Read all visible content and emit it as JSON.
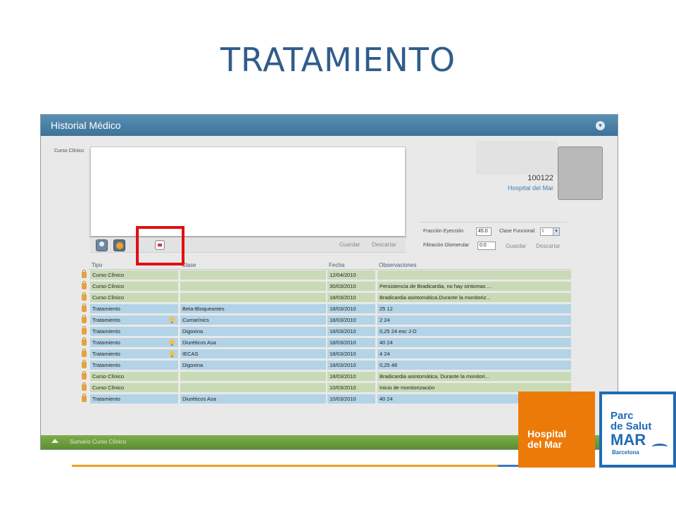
{
  "slide": {
    "title": "TRATAMIENTO"
  },
  "window": {
    "title": "Historial Médico",
    "collapse_icon": "chevron-down-icon"
  },
  "curso": {
    "label": "Curso Clínico",
    "text": "",
    "guardar": "Guardar",
    "descartar": "Descartar",
    "tool_icons": [
      "person-icon",
      "globe-icon",
      "pdf-icon"
    ]
  },
  "patient": {
    "id": "100122",
    "hospital": "Hospital del Mar"
  },
  "params": {
    "fraccion_label": "Fracción Eyección",
    "fraccion_value": "45.0",
    "clase_label": "Clase Funcional",
    "clase_value": "I",
    "filtracion_label": "Filtración Glomerular",
    "filtracion_value": "0.0",
    "guardar": "Guardar",
    "descartar": "Descartar"
  },
  "table": {
    "columns": [
      "Tipo",
      "Clase",
      "Fecha",
      "Observaciones"
    ],
    "rows": [
      {
        "tipo": "Curso Clínico",
        "clase": "",
        "fecha": "12/04/2010",
        "obs": "",
        "color": "green",
        "bulb": false
      },
      {
        "tipo": "Curso Clínico",
        "clase": "",
        "fecha": "30/03/2010",
        "obs": "Persistencia de Bradicardia, no hay síntomas ...",
        "color": "green",
        "bulb": false
      },
      {
        "tipo": "Curso Clínico",
        "clase": "",
        "fecha": "18/03/2010",
        "obs": "Bradicardia asintomática.Durante la monitoriz...",
        "color": "green",
        "bulb": false
      },
      {
        "tipo": "Tratamiento",
        "clase": "Beta-Bloqueantes",
        "fecha": "18/03/2010",
        "obs": "25 12",
        "color": "blue",
        "bulb": false
      },
      {
        "tipo": "Tratamiento",
        "clase": "Cumarínics",
        "fecha": "18/03/2010",
        "obs": "2 24",
        "color": "blue",
        "bulb": true
      },
      {
        "tipo": "Tratamiento",
        "clase": "Digoxina",
        "fecha": "18/03/2010",
        "obs": "0,25 24 exc J-D",
        "color": "blue",
        "bulb": false
      },
      {
        "tipo": "Tratamiento",
        "clase": "Diuréticos Asa",
        "fecha": "18/03/2010",
        "obs": "40 24",
        "color": "blue",
        "bulb": true
      },
      {
        "tipo": "Tratamiento",
        "clase": "IECAS",
        "fecha": "18/03/2010",
        "obs": "4 24",
        "color": "blue",
        "bulb": true
      },
      {
        "tipo": "Tratamiento",
        "clase": "Digoxina",
        "fecha": "18/03/2010",
        "obs": "0,25 48",
        "color": "blue",
        "bulb": false
      },
      {
        "tipo": "Curso Clínico",
        "clase": "",
        "fecha": "18/03/2010",
        "obs": "Bradicardia asintomática. Durante la monitori...",
        "color": "green",
        "bulb": false
      },
      {
        "tipo": "Curso Clínico",
        "clase": "",
        "fecha": "10/03/2010",
        "obs": "Inicio de monitorización",
        "color": "green",
        "bulb": false
      },
      {
        "tipo": "Tratamiento",
        "clase": "Diuréticos Asa",
        "fecha": "10/03/2010",
        "obs": "40 24",
        "color": "blue",
        "bulb": false
      }
    ]
  },
  "bottom_bar": {
    "label": "Sumario Curso Clínico",
    "icon": "chevron-up-icon"
  },
  "logos": {
    "hospital": "Hospital\ndel Mar",
    "parc_line1": "Parc",
    "parc_line2": "de Salut",
    "parc_line3": "MAR",
    "parc_line4": "Barcelona"
  },
  "colors": {
    "title": "#2f5d8a",
    "header": "#3d7299",
    "row_green": "#c9dbb6",
    "row_blue": "#b3d3e6",
    "highlight": "#e01010",
    "hospital_orange": "#ec7a09",
    "parc_blue": "#1f6bb5"
  }
}
